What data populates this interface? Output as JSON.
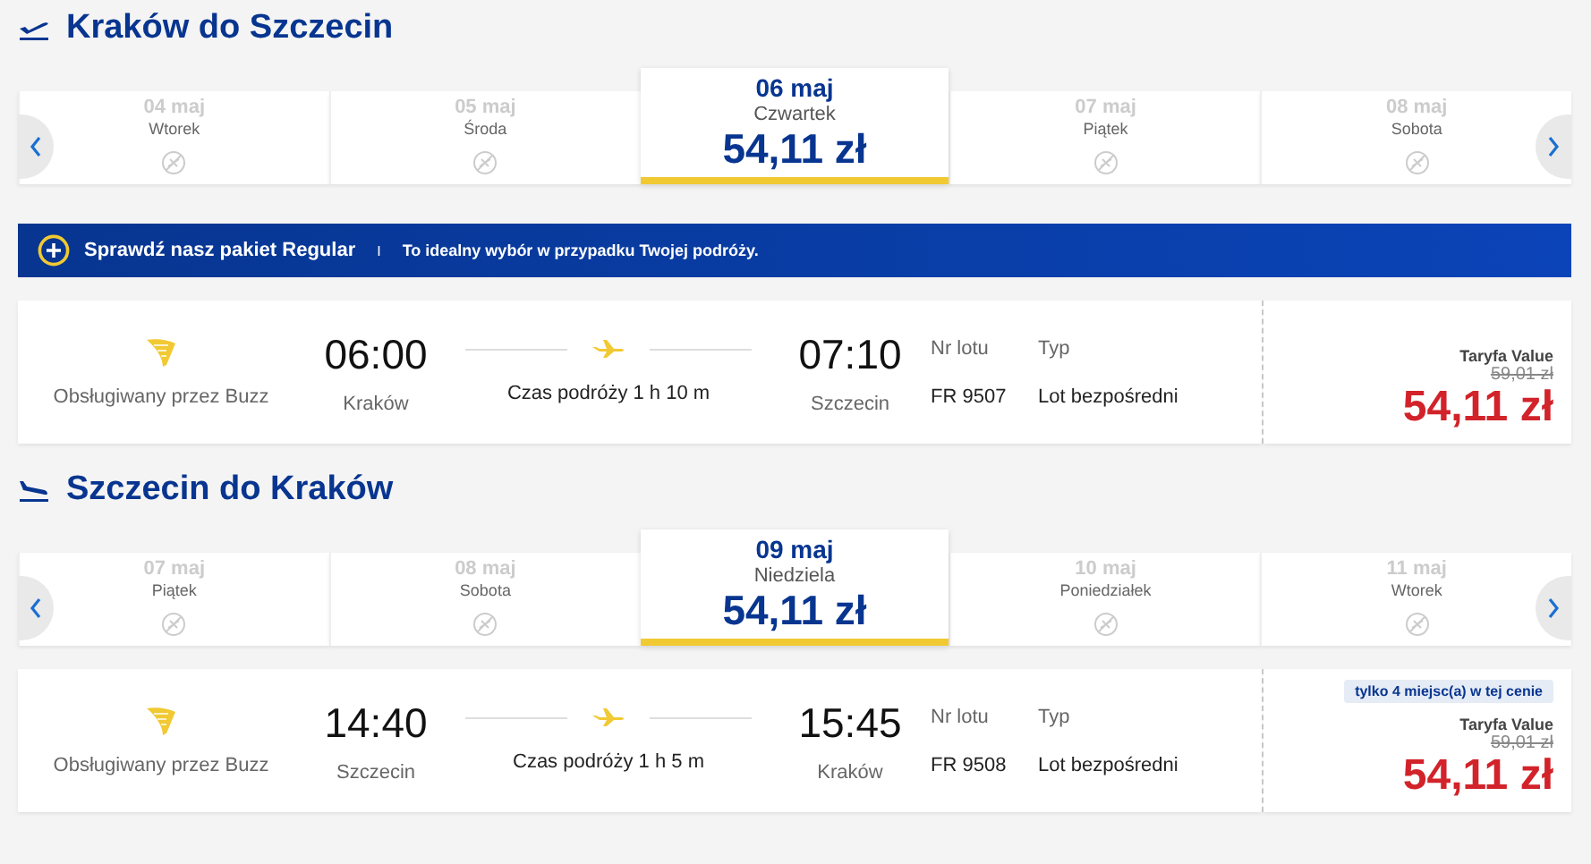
{
  "sections": [
    {
      "title": "Kraków do Szczecin",
      "kind": "departure",
      "dates": [
        {
          "date": "04 maj",
          "day": "Wtorek",
          "selected": false
        },
        {
          "date": "05 maj",
          "day": "Środa",
          "selected": false
        },
        {
          "date": "06 maj",
          "day": "Czwartek",
          "price": "54,11 zł",
          "selected": true
        },
        {
          "date": "07 maj",
          "day": "Piątek",
          "selected": false
        },
        {
          "date": "08 maj",
          "day": "Sobota",
          "selected": false
        }
      ],
      "banner": {
        "title": "Sprawdź nasz pakiet Regular",
        "separator": "I",
        "text": "To idealny wybór w przypadku Twojej podróży."
      },
      "flight": {
        "operator": "Obsługiwany przez Buzz",
        "depart_time": "06:00",
        "depart_city": "Kraków",
        "duration": "Czas podróży 1 h 10 m",
        "arrive_time": "07:10",
        "arrive_city": "Szczecin",
        "flight_no_label": "Nr lotu",
        "flight_no": "FR 9507",
        "type_label": "Typ",
        "type": "Lot bezpośredni",
        "fare": "Taryfa Value",
        "old_price": "59,01 zł",
        "price": "54,11 zł"
      }
    },
    {
      "title": "Szczecin do Kraków",
      "kind": "arrival",
      "dates": [
        {
          "date": "07 maj",
          "day": "Piątek",
          "selected": false
        },
        {
          "date": "08 maj",
          "day": "Sobota",
          "selected": false
        },
        {
          "date": "09 maj",
          "day": "Niedziela",
          "price": "54,11 zł",
          "selected": true
        },
        {
          "date": "10 maj",
          "day": "Poniedziałek",
          "selected": false
        },
        {
          "date": "11 maj",
          "day": "Wtorek",
          "selected": false
        }
      ],
      "flight": {
        "operator": "Obsługiwany przez Buzz",
        "depart_time": "14:40",
        "depart_city": "Szczecin",
        "duration": "Czas podróży 1 h 5 m",
        "arrive_time": "15:45",
        "arrive_city": "Kraków",
        "flight_no_label": "Nr lotu",
        "flight_no": "FR 9508",
        "type_label": "Typ",
        "type": "Lot bezpośredni",
        "badge": "tylko 4 miejsc(a) w tej cenie",
        "fare": "Taryfa Value",
        "old_price": "59,01 zł",
        "price": "54,11 zł"
      }
    }
  ]
}
